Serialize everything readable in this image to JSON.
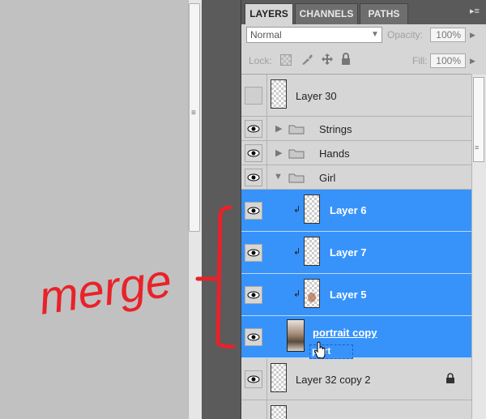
{
  "panel": {
    "tabs": [
      {
        "label": "LAYERS",
        "active": true
      },
      {
        "label": "CHANNELS",
        "active": false
      },
      {
        "label": "PATHS",
        "active": false
      }
    ],
    "menu_icon": "panel-menu-icon"
  },
  "options": {
    "blend_mode": "Normal",
    "opacity_label": "Opacity:",
    "opacity_value": "100%",
    "lock_label": "Lock:",
    "fill_label": "Fill:",
    "fill_value": "100%"
  },
  "layers": [
    {
      "name": "Layer 30",
      "type": "layer",
      "visible": false,
      "selected": false
    },
    {
      "name": "Strings",
      "type": "group",
      "expanded": false,
      "visible": true,
      "selected": false
    },
    {
      "name": "Hands",
      "type": "group",
      "expanded": false,
      "visible": true,
      "selected": false
    },
    {
      "name": "Girl",
      "type": "group",
      "expanded": true,
      "visible": true,
      "selected": false
    },
    {
      "name": "Layer 6",
      "type": "clipped-layer",
      "visible": true,
      "selected": true
    },
    {
      "name": "Layer 7",
      "type": "clipped-layer",
      "visible": true,
      "selected": true
    },
    {
      "name": "Layer 5",
      "type": "clipped-layer",
      "visible": true,
      "selected": true
    },
    {
      "name": "portrait copy",
      "type": "layer",
      "visible": true,
      "selected": true
    },
    {
      "name": "Layer 32 copy 2",
      "type": "layer",
      "visible": true,
      "selected": false,
      "locked": true
    }
  ],
  "drag_ghost": "port",
  "annotation": {
    "text": "merge",
    "color": "#e8222a"
  },
  "colors": {
    "selection": "#3793fa",
    "panel_bg": "#d6d6d6",
    "tabbar_bg": "#5a5a5a"
  }
}
